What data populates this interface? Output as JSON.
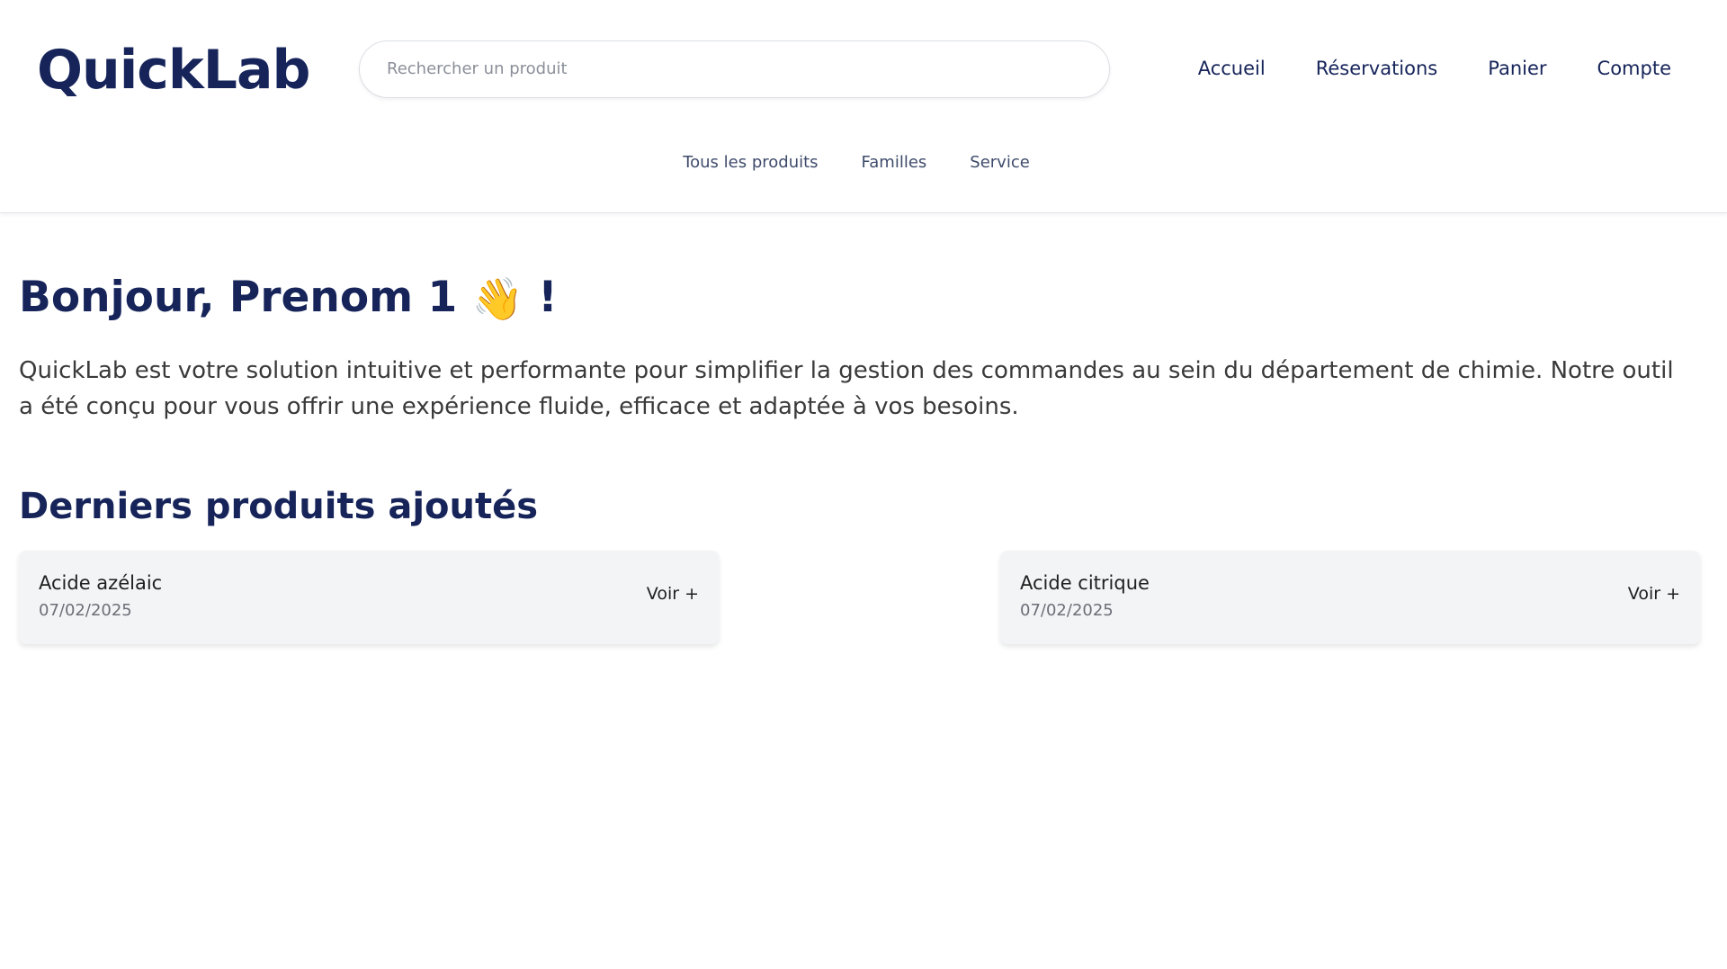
{
  "header": {
    "logo": "QuickLab",
    "search": {
      "placeholder": "Rechercher un produit",
      "value": ""
    },
    "nav": [
      "Accueil",
      "Réservations",
      "Panier",
      "Compte"
    ],
    "subnav": [
      "Tous les produits",
      "Familles",
      "Service"
    ]
  },
  "main": {
    "greeting": {
      "text": "Bonjour, Prenom 1",
      "emoji": "👋",
      "suffix": "!"
    },
    "intro": "QuickLab est votre solution intuitive et performante pour simplifier la gestion des commandes au sein du département de chimie. Notre outil a été conçu pour vous offrir une expérience fluide, efficace et adaptée à vos besoins.",
    "section_title": "Derniers produits ajoutés",
    "products": [
      {
        "name": "Acide azélaic",
        "date": "07/02/2025",
        "action": "Voir +"
      },
      {
        "name": "Acide citrique",
        "date": "07/02/2025",
        "action": "Voir +"
      }
    ]
  },
  "colors": {
    "brand": "#16245a",
    "card_bg": "#f3f4f6",
    "muted_text": "#6b6f76"
  }
}
